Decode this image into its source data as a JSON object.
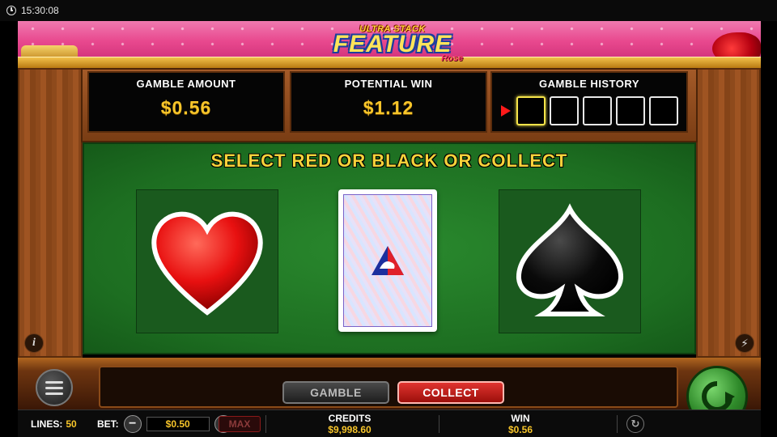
{
  "status_bar": {
    "time": "15:30:08"
  },
  "logo": {
    "line1": "ULTRA STACK",
    "line2": "FEATURE",
    "line3": "Rose"
  },
  "panels": {
    "gamble_amount_label": "GAMBLE AMOUNT",
    "gamble_amount_value": "$0.56",
    "potential_win_label": "POTENTIAL WIN",
    "potential_win_value": "$1.12",
    "gamble_history_label": "GAMBLE HISTORY",
    "history_slots": 5
  },
  "felt": {
    "prompt": "SELECT RED OR BLACK OR COLLECT",
    "choices": [
      "heart",
      "card-back",
      "spade"
    ]
  },
  "controls": {
    "gamble_label": "GAMBLE",
    "collect_label": "COLLECT"
  },
  "bottom": {
    "lines_label": "LINES:",
    "lines_value": "50",
    "bet_label": "BET:",
    "bet_value": "$0.50",
    "max_label": "MAX",
    "credits_label": "CREDITS",
    "credits_value": "$9,998.60",
    "win_label": "WIN",
    "win_value": "$0.56"
  },
  "colors": {
    "accent_gold": "#f7c52a",
    "felt_green": "#1d6e21",
    "collect_red": "#c9201b"
  }
}
